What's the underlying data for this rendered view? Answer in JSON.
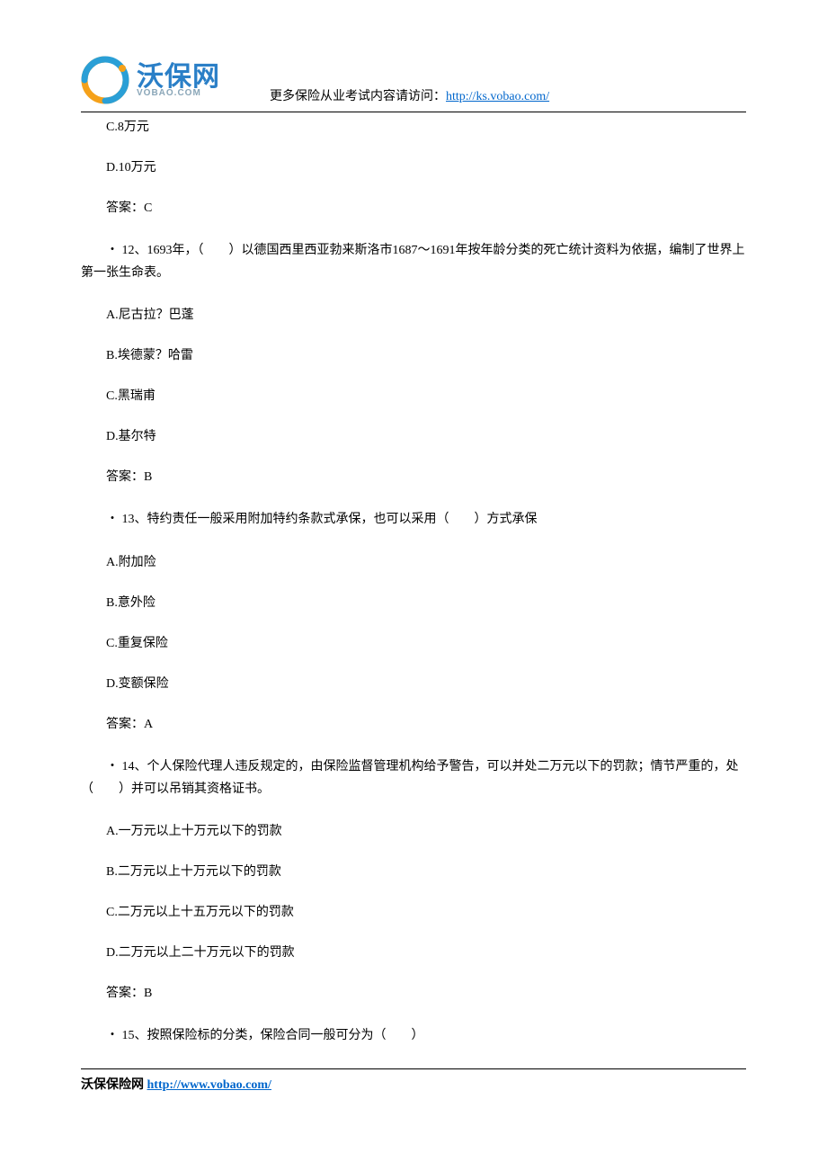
{
  "header": {
    "logo_main": "沃保网",
    "logo_sub": "VOBAO.COM",
    "lead_text": "更多保险从业考试内容请访问：",
    "link_text": "http://ks.vobao.com/"
  },
  "body": {
    "opt_c_prev": "C.8万元",
    "opt_d_prev": "D.10万元",
    "ans_prev": "答案：C",
    "q12": "・ 12、1693年，（　　）以德国西里西亚勃来斯洛市1687～1691年按年龄分类的死亡统计资料为依据，编制了世界上第一张生命表。",
    "q12_a": "A.尼古拉？巴蓬",
    "q12_b": "B.埃德蒙？哈雷",
    "q12_c": "C.黑瑞甫",
    "q12_d": "D.基尔特",
    "q12_ans": "答案：B",
    "q13": "・ 13、特约责任一般采用附加特约条款式承保，也可以采用（　　）方式承保",
    "q13_a": "A.附加险",
    "q13_b": "B.意外险",
    "q13_c": "C.重复保险",
    "q13_d": "D.变额保险",
    "q13_ans": "答案：A",
    "q14": "・ 14、个人保险代理人违反规定的，由保险监督管理机构给予警告，可以并处二万元以下的罚款；情节严重的，处（　　）并可以吊销其资格证书。",
    "q14_a": "A.一万元以上十万元以下的罚款",
    "q14_b": "B.二万元以上十万元以下的罚款",
    "q14_c": "C.二万元以上十五万元以下的罚款",
    "q14_d": "D.二万元以上二十万元以下的罚款",
    "q14_ans": "答案：B",
    "q15": "・ 15、按照保险标的分类，保险合同一般可分为（　　）"
  },
  "footer": {
    "label": "沃保保险网 ",
    "link_text": "http://www.vobao.com/"
  }
}
